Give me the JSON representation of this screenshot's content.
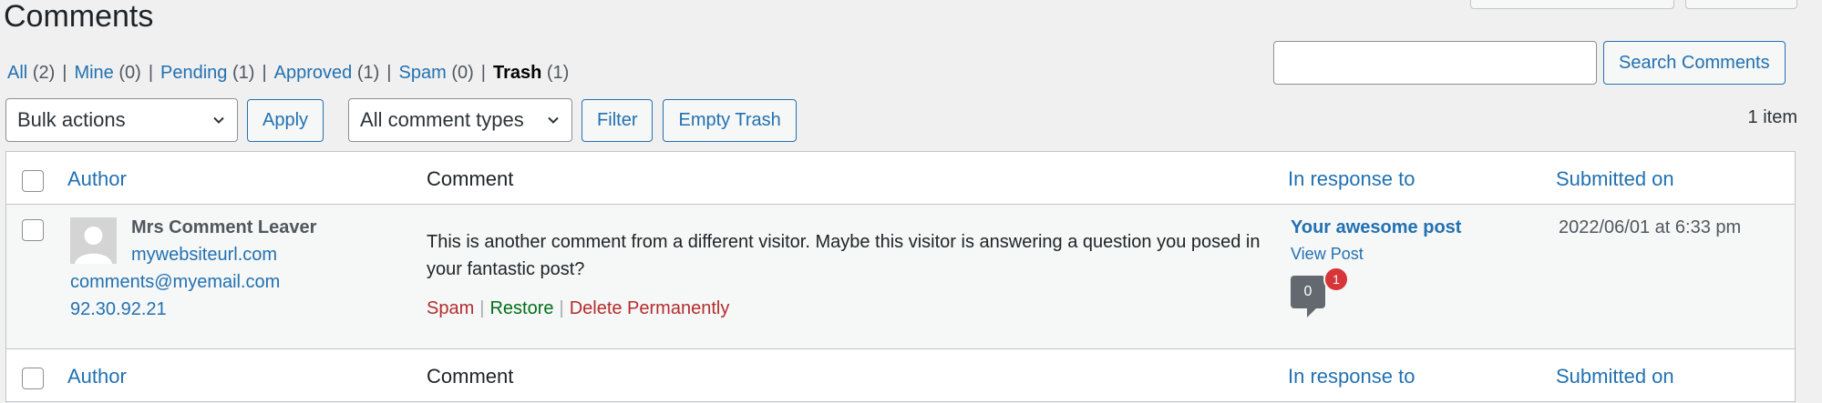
{
  "page": {
    "title": "Comments"
  },
  "filters": {
    "items": [
      {
        "label": "All",
        "count": "(2)"
      },
      {
        "label": "Mine",
        "count": "(0)"
      },
      {
        "label": "Pending",
        "count": "(1)"
      },
      {
        "label": "Approved",
        "count": "(1)"
      },
      {
        "label": "Spam",
        "count": "(0)"
      },
      {
        "label": "Trash",
        "count": "(1)"
      }
    ],
    "separator": "|"
  },
  "search": {
    "value": "",
    "button_label": "Search Comments"
  },
  "tablenav": {
    "bulk_actions": "Bulk actions",
    "apply_label": "Apply",
    "comment_types": "All comment types",
    "filter_label": "Filter",
    "empty_trash_label": "Empty Trash",
    "items_count": "1 item"
  },
  "columns": {
    "author": "Author",
    "comment": "Comment",
    "in_response_to": "In response to",
    "submitted_on": "Submitted on"
  },
  "comment": {
    "author_name": "Mrs Comment Leaver",
    "author_url": "mywebsiteurl.com",
    "author_email": "comments@myemail.com",
    "author_ip": "92.30.92.21",
    "text": "This is another comment from a different visitor. Maybe this visitor is answering a question you posed in your fantastic post?",
    "actions": {
      "spam": "Spam",
      "restore": "Restore",
      "delete": "Delete Permanently",
      "separator": "|"
    },
    "response": {
      "post_title": "Your awesome post",
      "view_post": "View Post",
      "approved_count": "0",
      "pending_count": "1"
    },
    "submitted": "2022/06/01 at 6:33 pm"
  },
  "colors": {
    "link": "#2271b1",
    "spam": "#b32d2e",
    "restore": "#007017",
    "badge": "#d63638",
    "bubble": "#646970"
  }
}
